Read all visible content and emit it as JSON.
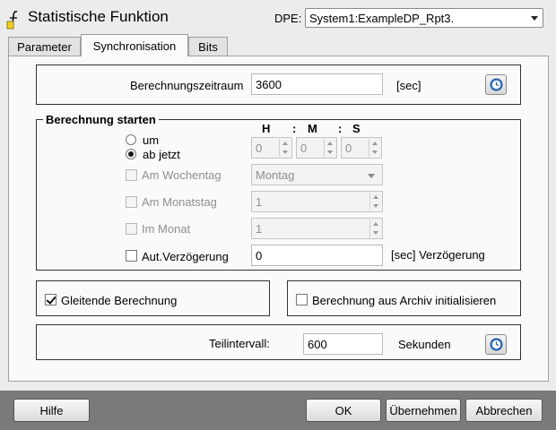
{
  "window": {
    "title": "Statistische Funktion"
  },
  "dpe": {
    "label": "DPE:",
    "value": "System1:ExampleDP_Rpt3."
  },
  "tabs": [
    {
      "label": "Parameter"
    },
    {
      "label": "Synchronisation"
    },
    {
      "label": "Bits"
    }
  ],
  "calc_period": {
    "label": "Berechnungszeitraum",
    "value": "3600",
    "unit": "[sec]",
    "icon": "clock-icon"
  },
  "start": {
    "legend": "Berechnung starten",
    "hms_headers": {
      "h": "H",
      "sep1": ":",
      "m": "M",
      "sep2": ":",
      "s": "S"
    },
    "radio_um": "um",
    "radio_now": "ab jetzt",
    "selected": "ab jetzt",
    "time_h": "0",
    "time_m": "0",
    "time_s": "0",
    "weekday_label": "Am Wochentag",
    "weekday_value": "Montag",
    "monthday_label": "Am Monatstag",
    "monthday_value": "1",
    "month_label": "Im Monat",
    "month_value": "1",
    "delay_label": "Aut.Verzögerung",
    "delay_value": "0",
    "delay_unit": "[sec] Verzögerung"
  },
  "sliding": {
    "label": "Gleitende Berechnung",
    "checked": true
  },
  "archive": {
    "label": "Berechnung aus Archiv initialisieren",
    "checked": false
  },
  "interval": {
    "label": "Teilintervall:",
    "value": "600",
    "unit": "Sekunden",
    "icon": "clock-icon"
  },
  "buttons": {
    "help": "Hilfe",
    "ok": "OK",
    "apply": "Übernehmen",
    "cancel": "Abbrechen"
  }
}
